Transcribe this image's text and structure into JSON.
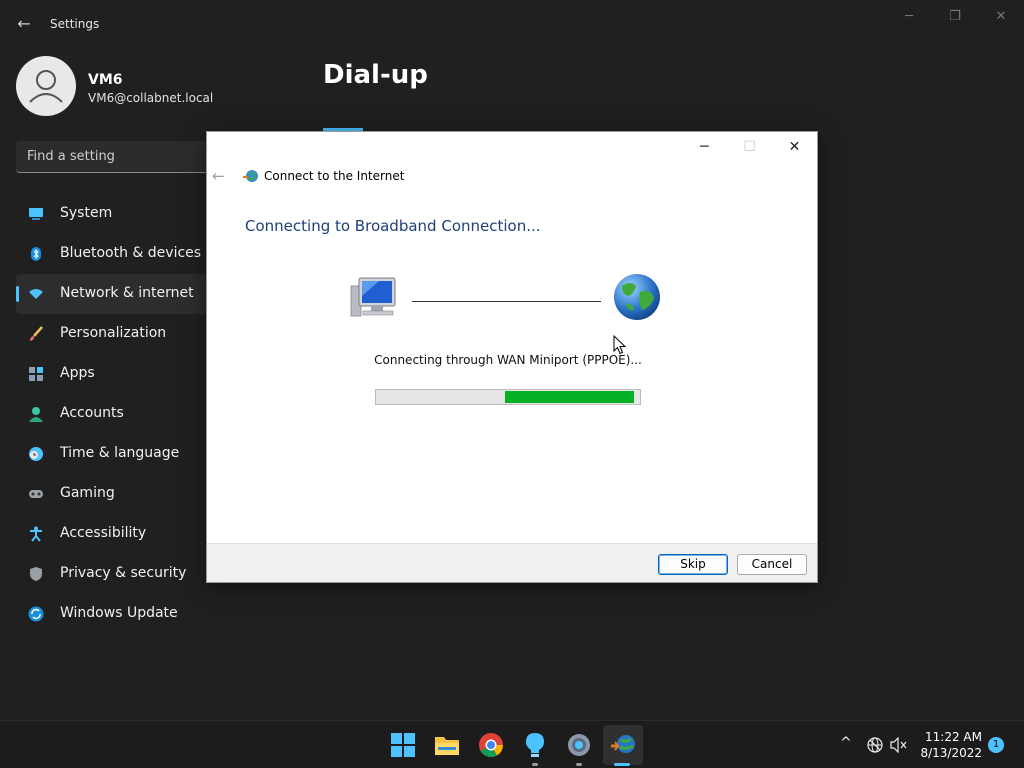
{
  "window": {
    "title": "Settings",
    "back_glyph": "←",
    "controls": {
      "minimize": "─",
      "restore": "❐",
      "close": "✕"
    }
  },
  "profile": {
    "name": "VM6",
    "email": "VM6@collabnet.local"
  },
  "search": {
    "placeholder": "Find a setting"
  },
  "nav": {
    "items": [
      {
        "label": "System",
        "icon": "system-icon"
      },
      {
        "label": "Bluetooth & devices",
        "icon": "bluetooth-icon"
      },
      {
        "label": "Network & internet",
        "icon": "wifi-icon",
        "active": true
      },
      {
        "label": "Personalization",
        "icon": "brush-icon"
      },
      {
        "label": "Apps",
        "icon": "apps-icon"
      },
      {
        "label": "Accounts",
        "icon": "person-icon"
      },
      {
        "label": "Time & language",
        "icon": "clock-globe-icon"
      },
      {
        "label": "Gaming",
        "icon": "controller-icon"
      },
      {
        "label": "Accessibility",
        "icon": "accessibility-icon"
      },
      {
        "label": "Privacy & security",
        "icon": "shield-icon"
      },
      {
        "label": "Windows Update",
        "icon": "update-icon"
      }
    ]
  },
  "page": {
    "title": "Dial-up"
  },
  "dialog": {
    "title": "Connect to the Internet",
    "heading": "Connecting to Broadband Connection...",
    "status": "Connecting through WAN Miniport (PPPOE)...",
    "progress": {
      "fill_start": 0.49,
      "fill_end": 0.98
    },
    "controls": {
      "minimize": "─",
      "maximize": "☐",
      "close": "✕"
    },
    "back_glyph": "←",
    "buttons": {
      "skip": "Skip",
      "cancel": "Cancel"
    }
  },
  "taskbar": {
    "apps": [
      "start-icon",
      "file-explorer-icon",
      "chrome-icon",
      "tips-icon",
      "settings-icon",
      "network-connection-icon"
    ],
    "tray": {
      "chevron": "^",
      "mute": "🔇"
    },
    "clock": {
      "time": "11:22 AM",
      "date": "8/13/2022"
    },
    "notifications": "1"
  },
  "colors": {
    "accent": "#4cc2ff",
    "progress": "#06b025",
    "heading": "#1e3f7a"
  }
}
